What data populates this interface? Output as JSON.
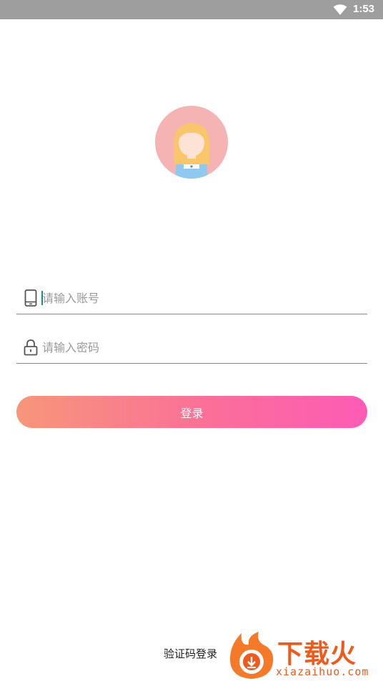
{
  "status_bar": {
    "time": "1:53"
  },
  "login_form": {
    "account_placeholder": "请输入账号",
    "password_placeholder": "请输入密码",
    "login_label": "登录"
  },
  "footer": {
    "sms_login_label": "验证码登录"
  },
  "watermark": {
    "brand": "下载火",
    "url": "xiazaihuo.com"
  },
  "colors": {
    "gradient_start": "#f7967a",
    "gradient_end": "#fd5bb6",
    "avatar_bg": "#f5b3b3",
    "watermark": "#f05a1a"
  }
}
